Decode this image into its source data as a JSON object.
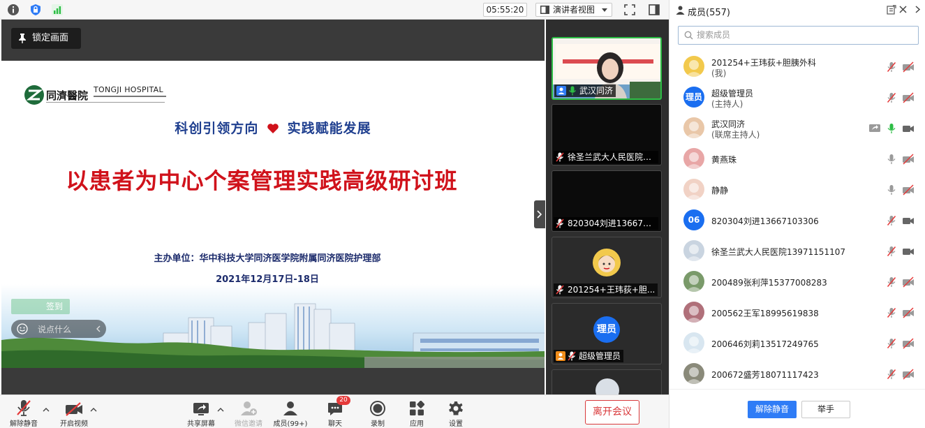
{
  "topbar": {
    "timer": "05:55:20",
    "view_mode": "演讲者视图"
  },
  "share": {
    "lock_label": "锁定画面"
  },
  "slide": {
    "logo_text": "同濟醫院",
    "logo_en": "TONGJI HOSPITAL",
    "slogan_left": "科创引领方向",
    "slogan_right": "实践赋能发展",
    "title": "以患者为中心个案管理实践高级研讨班",
    "organizer": "主办单位：华中科技大学同济医学院附属同济医院护理部",
    "date": "2021年12月17日-18日",
    "checkin": "签到",
    "chat_placeholder": "说点什么"
  },
  "tiles": [
    {
      "label": "武汉同济"
    },
    {
      "label": "徐圣兰武大人民医院1..."
    },
    {
      "label": "820304刘进1366710..."
    },
    {
      "label": "201254+王玮荻+胆..."
    },
    {
      "label": "超级管理员",
      "avatar_text": "理员"
    }
  ],
  "controls": {
    "unmute": "解除静音",
    "video": "开启视频",
    "share": "共享屏幕",
    "wechat": "微信邀请",
    "members": "成员(99+)",
    "chat": "聊天",
    "chat_badge": "20",
    "record": "录制",
    "apps": "应用",
    "settings": "设置",
    "leave": "离开会议"
  },
  "panel": {
    "title": "成员(557)",
    "search_placeholder": "搜索成员",
    "mute_all": "解除静音",
    "raise_hand": "举手",
    "members": [
      {
        "name": "201254+王玮荻+胆胰外科",
        "role": "(我)",
        "avatar": "photo"
      },
      {
        "name": "超级管理员",
        "role": "(主持人)",
        "avatar_text": "理员"
      },
      {
        "name": "武汉同济",
        "role": "(联席主持人)",
        "avatar": "photo"
      },
      {
        "name": "黄燕珠",
        "role": "",
        "avatar": "photo"
      },
      {
        "name": "静静",
        "role": "",
        "avatar": "photo"
      },
      {
        "name": "820304刘进13667103306",
        "role": "",
        "avatar_text": "06"
      },
      {
        "name": "徐圣兰武大人民医院13971151107",
        "role": "",
        "avatar": "photo"
      },
      {
        "name": "200489张利萍15377008283",
        "role": "",
        "avatar": "photo"
      },
      {
        "name": "200562王军18995619838",
        "role": "",
        "avatar": "photo"
      },
      {
        "name": "200646刘莉13517249765",
        "role": "",
        "avatar": "photo"
      },
      {
        "name": "200672盛芳18071117423",
        "role": "",
        "avatar": "photo"
      }
    ]
  },
  "colors": {
    "accent": "#2f7cf6",
    "leave": "#d9393b",
    "title_red": "#d0121b",
    "slogan_blue": "#1f3f8f",
    "mic_on": "#2dbd45"
  }
}
